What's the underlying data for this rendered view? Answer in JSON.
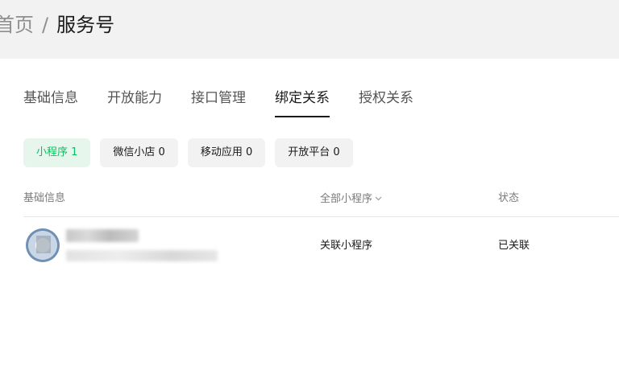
{
  "breadcrumb": {
    "home": "首页",
    "separator": "/",
    "current": "服务号"
  },
  "tabs": [
    {
      "label": "基础信息",
      "active": false
    },
    {
      "label": "开放能力",
      "active": false
    },
    {
      "label": "接口管理",
      "active": false
    },
    {
      "label": "绑定关系",
      "active": true
    },
    {
      "label": "授权关系",
      "active": false
    }
  ],
  "chips": [
    {
      "label": "小程序 1",
      "active": true
    },
    {
      "label": "微信小店 0",
      "active": false
    },
    {
      "label": "移动应用 0",
      "active": false
    },
    {
      "label": "开放平台 0",
      "active": false
    }
  ],
  "table": {
    "headers": {
      "basic": "基础信息",
      "filter": "全部小程序",
      "status": "状态"
    },
    "rows": [
      {
        "relation": "关联小程序",
        "status": "已关联"
      }
    ]
  },
  "colors": {
    "accent": "#07c160",
    "accent_bg": "#e6f6ec",
    "topbar_bg": "#f2f2f2"
  }
}
